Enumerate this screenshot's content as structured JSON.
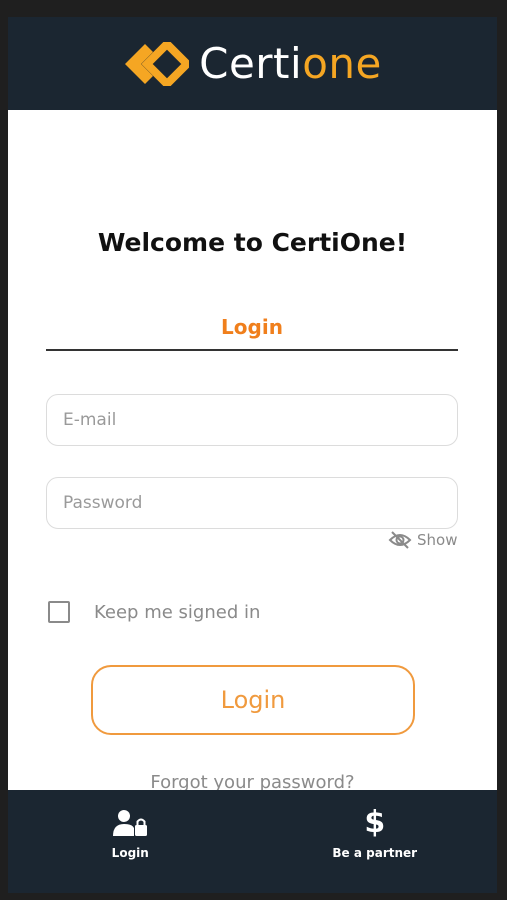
{
  "brand": {
    "logo_part1": "Certi",
    "logo_part2": "one",
    "accent_color": "#f5a623"
  },
  "welcome": {
    "title": "Welcome to CertiOne!"
  },
  "tabs": {
    "login_label": "Login"
  },
  "form": {
    "email_placeholder": "E-mail",
    "email_value": "",
    "password_placeholder": "Password",
    "password_value": "",
    "show_label": "Show",
    "keep_signed_in_label": "Keep me signed in",
    "keep_signed_in_checked": false,
    "login_button": "Login",
    "forgot_password": "Forgot your password?"
  },
  "bottom_nav": {
    "items": [
      {
        "label": "Login",
        "icon": "user-lock-icon"
      },
      {
        "label": "Be a partner",
        "icon": "dollar-icon"
      }
    ]
  },
  "colors": {
    "header_bg": "#1b2631",
    "orange": "#f07f1c",
    "button_orange": "#f09a3e"
  }
}
